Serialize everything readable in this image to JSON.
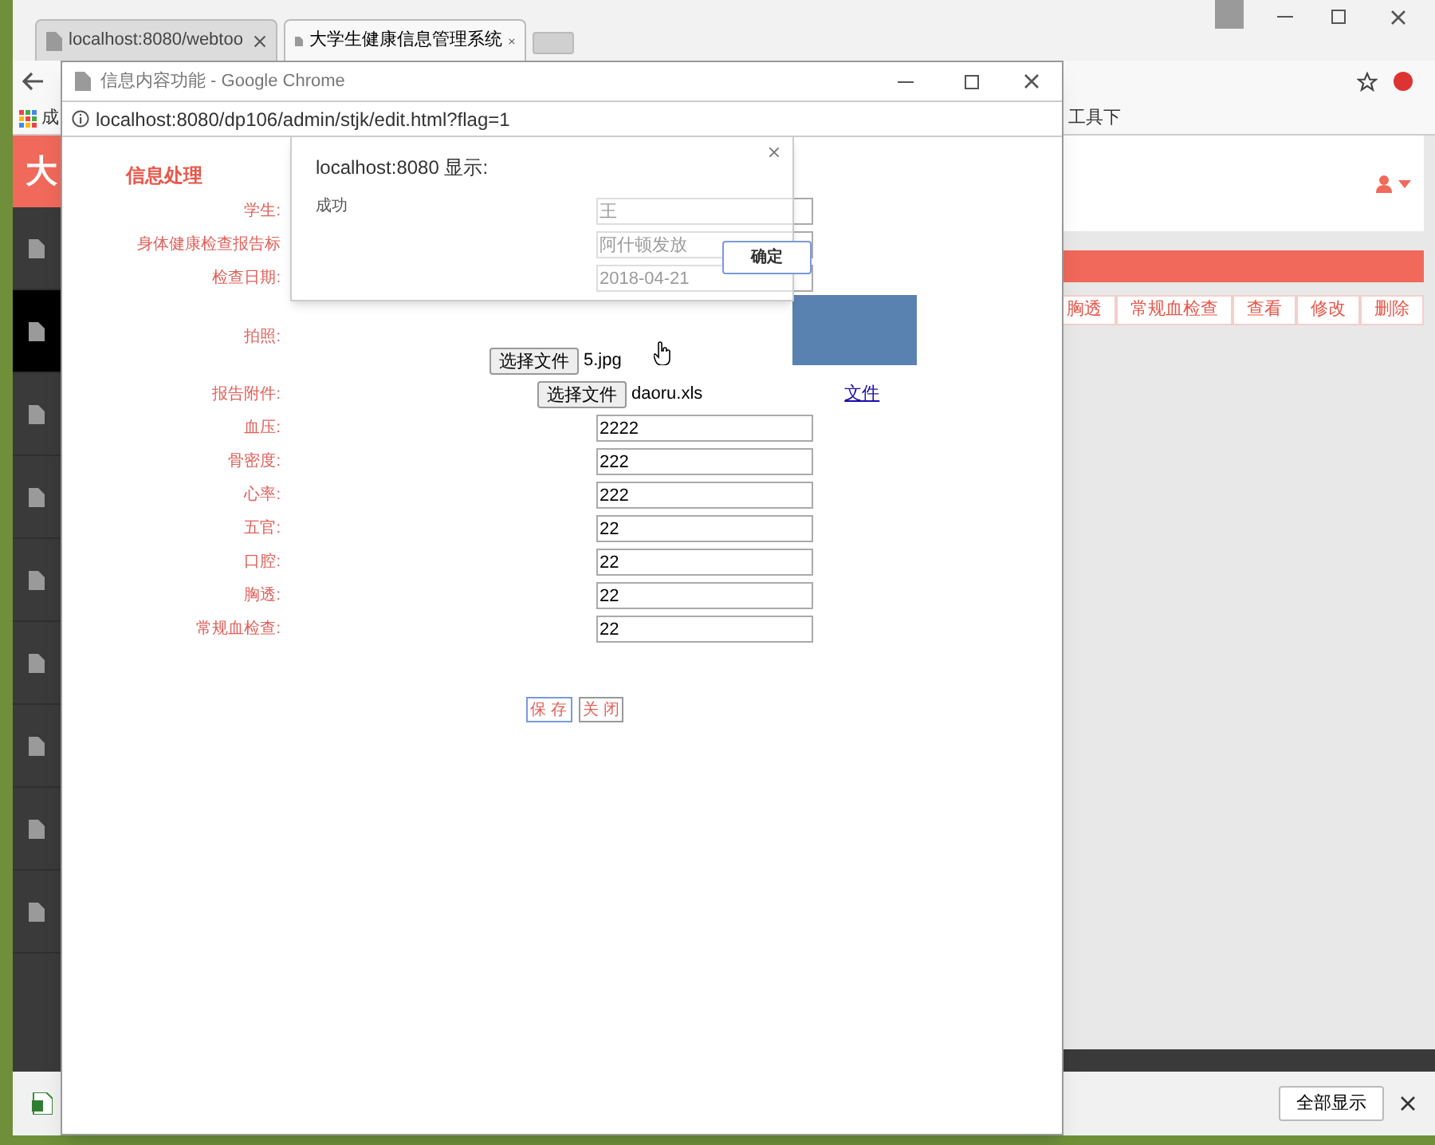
{
  "browser": {
    "tabs": [
      {
        "title": "localhost:8080/webtoo",
        "selected": false
      },
      {
        "title": "大学生健康信息管理系统",
        "selected": true
      }
    ],
    "bookmarks": [
      "成",
      "工具下"
    ]
  },
  "back_page": {
    "brand": "大",
    "sidebar": [
      {
        "selected": false
      },
      {
        "selected": true
      },
      {
        "selected": false
      },
      {
        "selected": false
      },
      {
        "selected": false
      },
      {
        "selected": false
      },
      {
        "selected": false
      },
      {
        "selected": false
      },
      {
        "selected": false
      }
    ],
    "table_headers": [
      "胸透",
      "常规血检查",
      "查看",
      "修改",
      "删除"
    ]
  },
  "popup": {
    "title": "信息内容功能 - Google Chrome",
    "url": "localhost:8080/dp106/admin/stjk/edit.html?flag=1",
    "heading": "信息处理",
    "fields": [
      {
        "kind": "text",
        "label": "学生:",
        "value": "王"
      },
      {
        "kind": "text",
        "label": "身体健康检查报告标",
        "value": "阿什顿发放"
      },
      {
        "kind": "text",
        "label": "检查日期:",
        "value": "2018-04-21"
      },
      {
        "kind": "image",
        "label": "拍照:",
        "button": "选择文件",
        "filename": "5.jpg"
      },
      {
        "kind": "file",
        "label": "报告附件:",
        "button": "选择文件",
        "filename": "daoru.xls",
        "link": "文件"
      },
      {
        "kind": "text",
        "label": "血压:",
        "value": "2222"
      },
      {
        "kind": "text",
        "label": "骨密度:",
        "value": "222"
      },
      {
        "kind": "text",
        "label": "心率:",
        "value": "222"
      },
      {
        "kind": "text",
        "label": "五官:",
        "value": "22"
      },
      {
        "kind": "text",
        "label": "口腔:",
        "value": "22"
      },
      {
        "kind": "text",
        "label": "胸透:",
        "value": "22"
      },
      {
        "kind": "text",
        "label": "常规血检查:",
        "value": "22"
      }
    ],
    "buttons": [
      "保 存",
      "关 闭"
    ]
  },
  "alert": {
    "title": "localhost:8080 显示:",
    "message": "成功",
    "button": "确定"
  },
  "download_bar": {
    "button": "全部显示"
  }
}
